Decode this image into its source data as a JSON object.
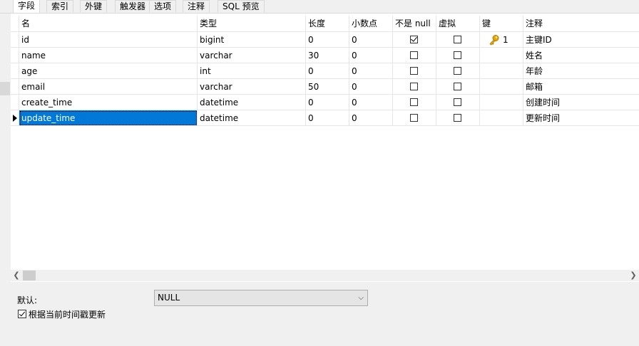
{
  "tabs": [
    "字段",
    "索引",
    "外键",
    "触发器",
    "选项",
    "注释",
    "SQL 预览"
  ],
  "columns": [
    "名",
    "类型",
    "长度",
    "小数点",
    "不是 null",
    "虚拟",
    "键",
    "注释"
  ],
  "rows": [
    {
      "name": "id",
      "type": "bigint",
      "length": "0",
      "decimals": "0",
      "not_null": true,
      "virtual": false,
      "key": "1",
      "comment": "主键ID"
    },
    {
      "name": "name",
      "type": "varchar",
      "length": "30",
      "decimals": "0",
      "not_null": false,
      "virtual": false,
      "key": "",
      "comment": "姓名"
    },
    {
      "name": "age",
      "type": "int",
      "length": "0",
      "decimals": "0",
      "not_null": false,
      "virtual": false,
      "key": "",
      "comment": "年龄"
    },
    {
      "name": "email",
      "type": "varchar",
      "length": "50",
      "decimals": "0",
      "not_null": false,
      "virtual": false,
      "key": "",
      "comment": "邮箱"
    },
    {
      "name": "create_time",
      "type": "datetime",
      "length": "0",
      "decimals": "0",
      "not_null": false,
      "virtual": false,
      "key": "",
      "comment": "创建时间"
    },
    {
      "name": "update_time",
      "type": "datetime",
      "length": "0",
      "decimals": "0",
      "not_null": false,
      "virtual": false,
      "key": "",
      "comment": "更新时间"
    }
  ],
  "bottom": {
    "default_label": "默认:",
    "default_value": "NULL",
    "on_update_label": "根据当前时间戳更新"
  },
  "colors": {
    "selection": "#0078d7",
    "key_icon": "#e6a800"
  }
}
